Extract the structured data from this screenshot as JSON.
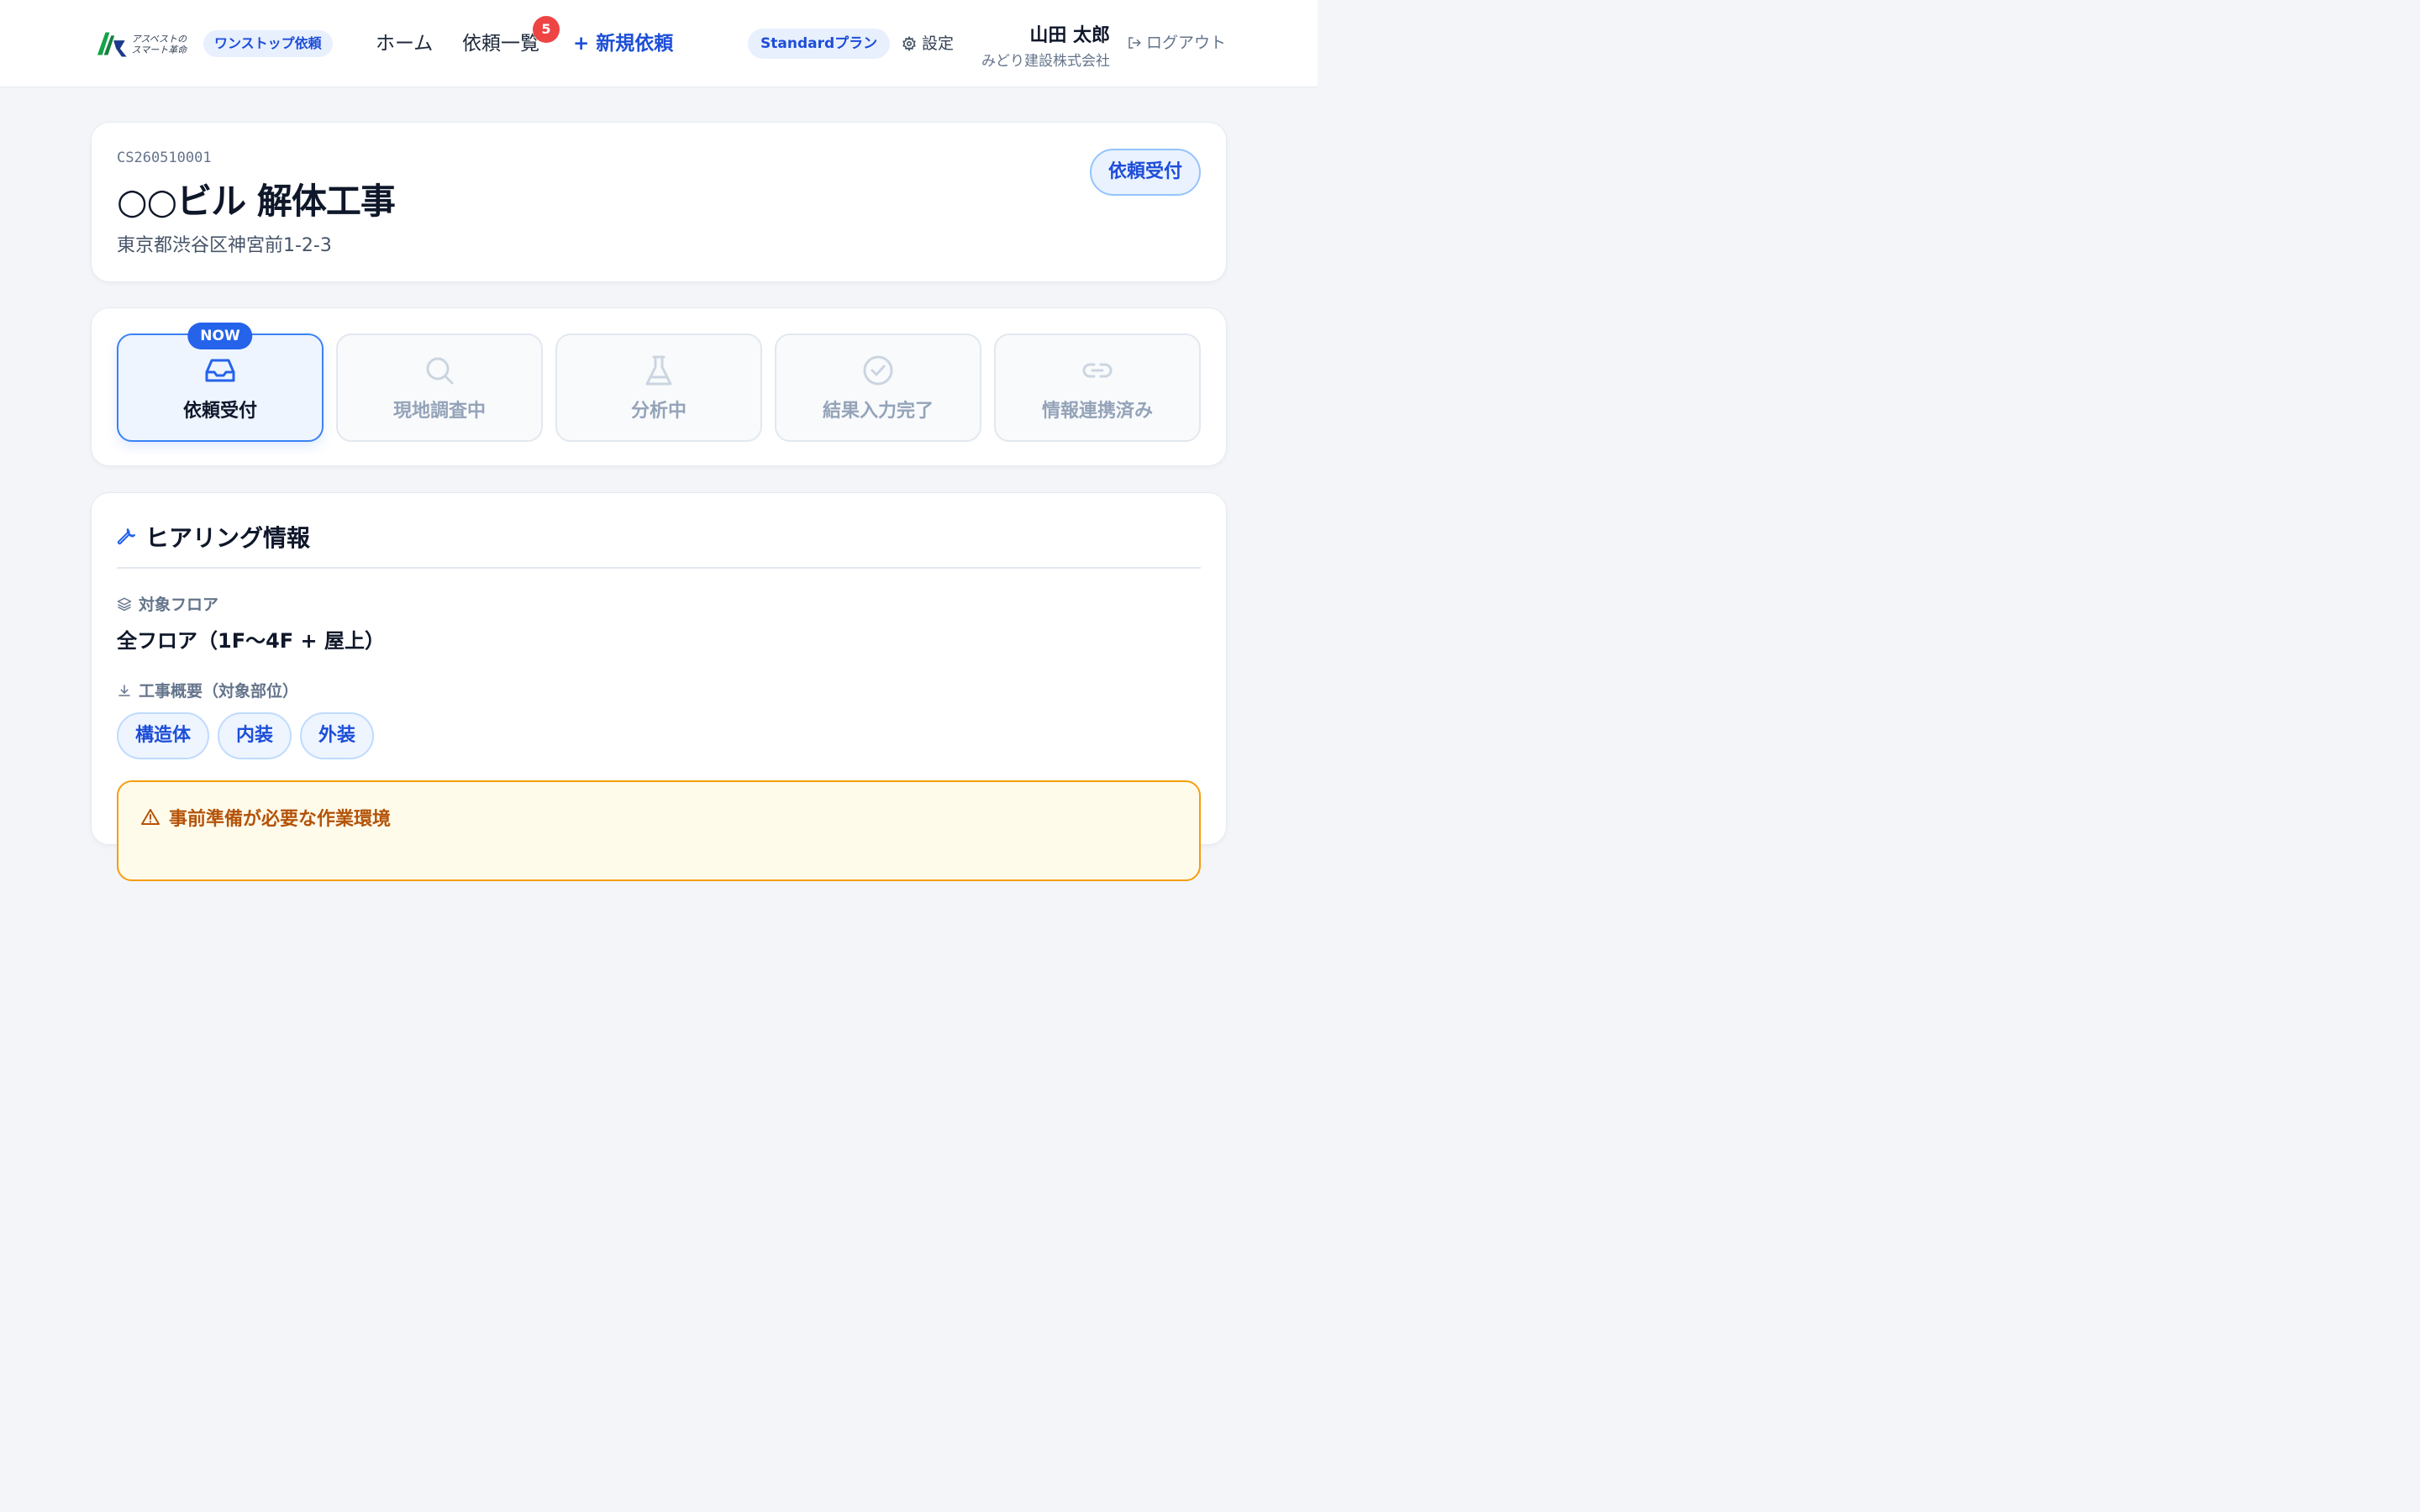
{
  "header": {
    "logo_text_line1": "アスベストの",
    "logo_text_line2": "スマート革命",
    "onestop_label": "ワンストップ依頼",
    "nav_home": "ホーム",
    "nav_list": "依頼一覧",
    "nav_list_badge": "5",
    "nav_new": "+ 新規依頼",
    "plan_label": "Standardプラン",
    "settings_label": "設定",
    "user_name": "山田 太郎",
    "user_company": "みどり建設株式会社",
    "logout_label": "ログアウト"
  },
  "case": {
    "id": "CS260510001",
    "name": "○○ビル 解体工事",
    "address": "東京都渋谷区神宮前1-2-3",
    "status": "依頼受付"
  },
  "steps": {
    "now_tag": "NOW",
    "items": [
      {
        "label": "依頼受付",
        "icon": "inbox-icon",
        "active": true
      },
      {
        "label": "現地調査中",
        "icon": "search-icon",
        "active": false
      },
      {
        "label": "分析中",
        "icon": "flask-icon",
        "active": false
      },
      {
        "label": "結果入力完了",
        "icon": "check-circle-icon",
        "active": false
      },
      {
        "label": "情報連携済み",
        "icon": "link-icon",
        "active": false
      }
    ]
  },
  "hearing": {
    "title": "ヒアリング情報",
    "floor_label": "対象フロア",
    "floor_value": "全フロア（1F〜4F + 屋上）",
    "scope_label": "工事概要（対象部位）",
    "scope_chips": [
      "構造体",
      "内装",
      "外装"
    ],
    "warning_title": "事前準備が必要な作業環境"
  },
  "colors": {
    "accent": "#1d4ed8",
    "accent_light": "#eef5ff",
    "badge": "#ef4444",
    "warning": "#f59e0b",
    "background": "#f3f5f9"
  }
}
